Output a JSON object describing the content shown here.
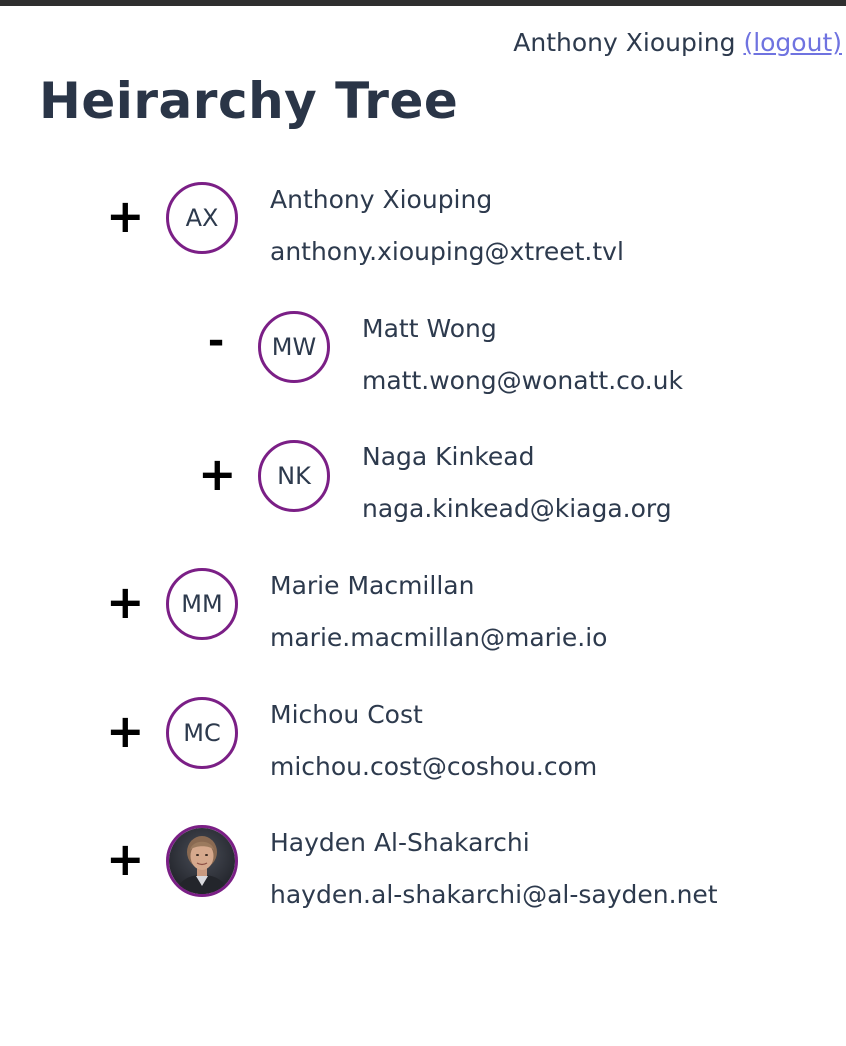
{
  "header": {
    "user_name": "Anthony Xiouping",
    "logout_label": "(logout)"
  },
  "page": {
    "title": "Heirarchy Tree"
  },
  "tree": {
    "nodes": [
      {
        "toggle": "+",
        "initials": "AX",
        "name": "Anthony Xiouping",
        "email": "anthony.xiouping@xtreet.tvl"
      },
      {
        "toggle": "-",
        "initials": "MW",
        "name": "Matt Wong",
        "email": "matt.wong@wonatt.co.uk"
      },
      {
        "toggle": "+",
        "initials": "NK",
        "name": "Naga Kinkead",
        "email": "naga.kinkead@kiaga.org"
      },
      {
        "toggle": "+",
        "initials": "MM",
        "name": "Marie Macmillan",
        "email": "marie.macmillan@marie.io"
      },
      {
        "toggle": "+",
        "initials": "MC",
        "name": "Michou Cost",
        "email": "michou.cost@coshou.com"
      },
      {
        "toggle": "+",
        "initials": "",
        "name": "Hayden Al-Shakarchi",
        "email": "hayden.al-shakarchi@al-sayden.net",
        "avatar": "photo"
      }
    ]
  },
  "colors": {
    "avatar_border": "#7b1f86",
    "link": "#6f73e0",
    "text": "#2d3a4d",
    "top_bar": "#2f2f2f"
  }
}
